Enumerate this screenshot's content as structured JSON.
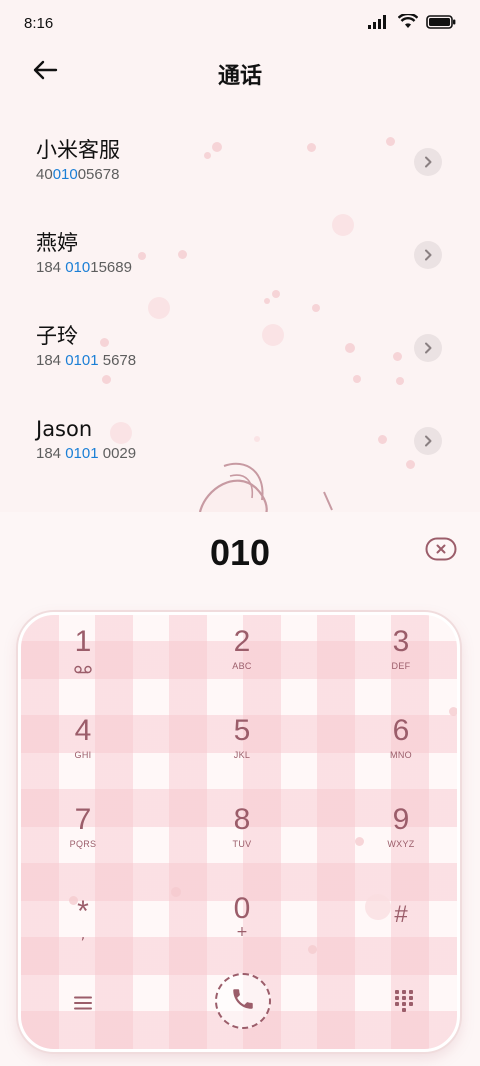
{
  "status_bar": {
    "time": "8:16"
  },
  "header": {
    "title": "通话"
  },
  "contacts": [
    {
      "name": "小米客服",
      "number_pre": "40",
      "number_match": "010",
      "number_post": "05678"
    },
    {
      "name": "燕婷",
      "number_pre": "184 ",
      "number_match": "010",
      "number_post": "15689"
    },
    {
      "name": "子玲",
      "number_pre": "184 ",
      "number_match": "0101",
      "number_post": " 5678"
    },
    {
      "name": "Jason",
      "number_pre": "184 ",
      "number_match": "0101",
      "number_post": " 0029"
    }
  ],
  "dialer": {
    "number": "010"
  },
  "keypad": {
    "keys": [
      {
        "digit": "1",
        "letters": ""
      },
      {
        "digit": "2",
        "letters": "ABC"
      },
      {
        "digit": "3",
        "letters": "DEF"
      },
      {
        "digit": "4",
        "letters": "GHI"
      },
      {
        "digit": "5",
        "letters": "JKL"
      },
      {
        "digit": "6",
        "letters": "MNO"
      },
      {
        "digit": "7",
        "letters": "PQRS"
      },
      {
        "digit": "8",
        "letters": "TUV"
      },
      {
        "digit": "9",
        "letters": "WXYZ"
      },
      {
        "digit": "*",
        "letters": ","
      },
      {
        "digit": "0",
        "letters": "+"
      },
      {
        "digit": "#",
        "letters": ""
      }
    ]
  },
  "colors": {
    "background": "#fcf3f3",
    "accent_match": "#1b7fd6",
    "keypad_text": "#9b5d6a",
    "plaid": "#f6c4cb"
  },
  "icons": {
    "back": "back-arrow-icon",
    "detail": "chevron-right-icon",
    "delete": "backspace-icon",
    "voicemail": "voicemail-icon",
    "menu": "menu-icon",
    "call": "phone-icon",
    "dialpad": "dialpad-icon"
  }
}
